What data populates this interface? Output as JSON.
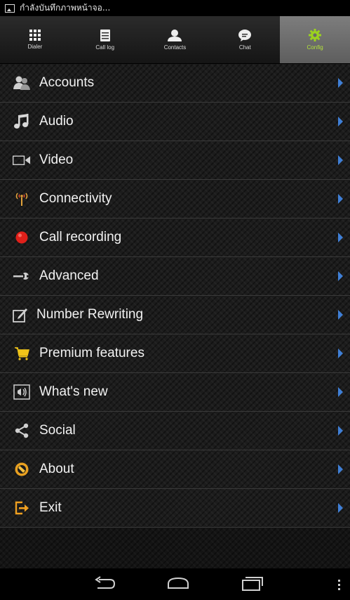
{
  "status_bar": {
    "text": "กำลังบันทึกภาพหน้าจอ..."
  },
  "tabs": [
    {
      "label": "Dialer",
      "icon": "dialpad-icon",
      "active": false
    },
    {
      "label": "Call log",
      "icon": "call-log-icon",
      "active": false
    },
    {
      "label": "Contacts",
      "icon": "contacts-icon",
      "active": false
    },
    {
      "label": "Chat",
      "icon": "chat-bubble-icon",
      "active": false
    },
    {
      "label": "Config",
      "icon": "gear-icon",
      "active": true
    }
  ],
  "menu": [
    {
      "label": "Accounts",
      "icon": "accounts-icon"
    },
    {
      "label": "Audio",
      "icon": "music-note-icon"
    },
    {
      "label": "Video",
      "icon": "video-camera-icon"
    },
    {
      "label": "Connectivity",
      "icon": "antenna-icon"
    },
    {
      "label": "Call recording",
      "icon": "record-icon"
    },
    {
      "label": "Advanced",
      "icon": "wrench-icon"
    },
    {
      "label": "Number Rewriting",
      "icon": "edit-icon"
    },
    {
      "label": "Premium features",
      "icon": "cart-icon"
    },
    {
      "label": "What's new",
      "icon": "megaphone-icon"
    },
    {
      "label": "Social",
      "icon": "share-icon"
    },
    {
      "label": "About",
      "icon": "about-icon"
    },
    {
      "label": "Exit",
      "icon": "exit-icon"
    }
  ],
  "colors": {
    "active_tab_label": "#b5e43a",
    "chevron": "#3f7fd6",
    "record": "#e0201a"
  }
}
